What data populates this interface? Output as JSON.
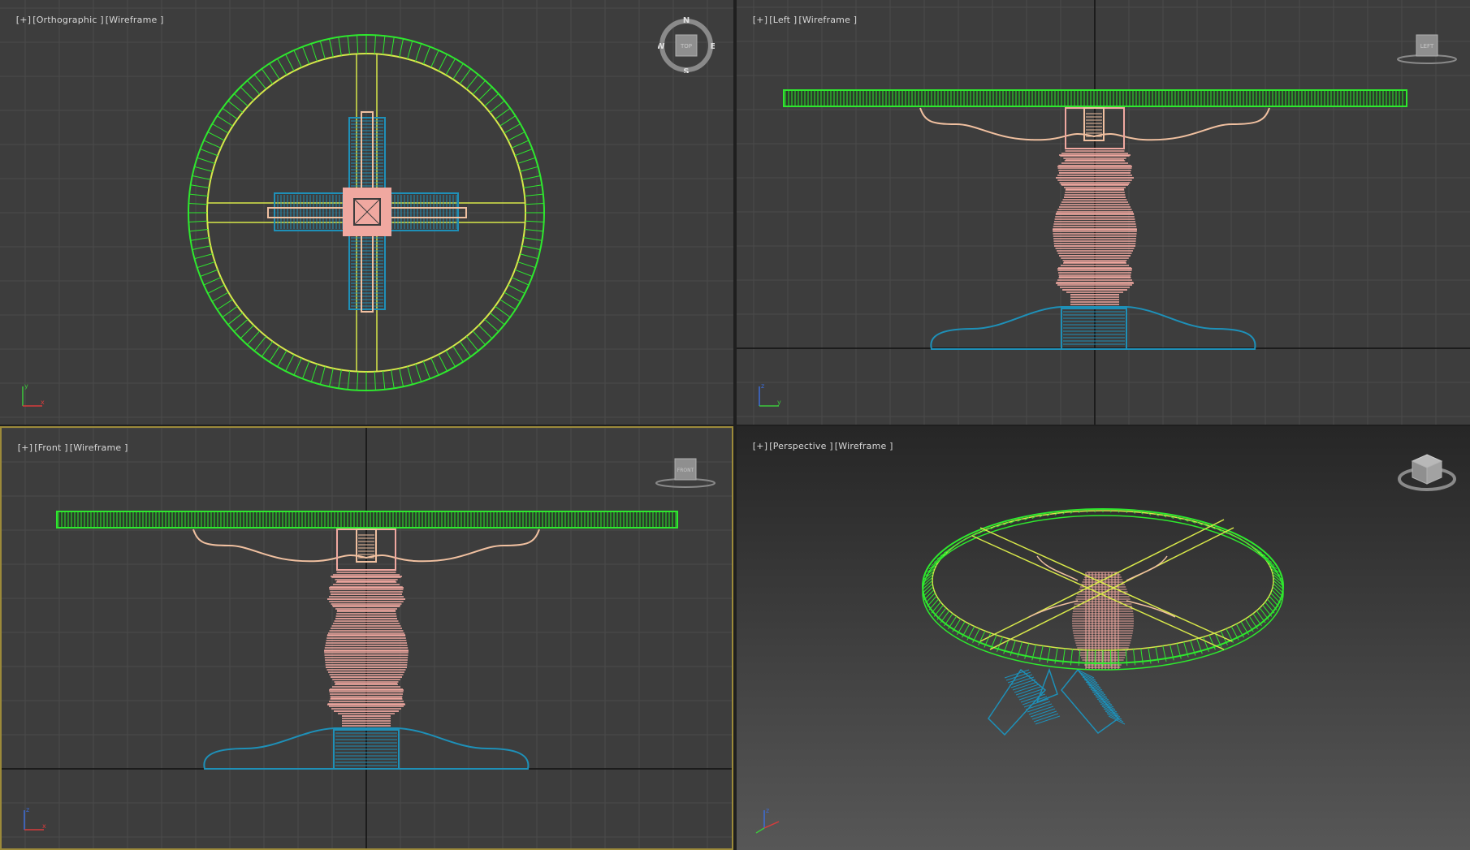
{
  "viewports": {
    "top": {
      "plus": "[+]",
      "view": "[Orthographic ]",
      "shading": "[Wireframe ]"
    },
    "left": {
      "plus": "[+]",
      "view": "[Left ]",
      "shading": "[Wireframe ]"
    },
    "front": {
      "plus": "[+]",
      "view": "[Front ]",
      "shading": "[Wireframe ]"
    },
    "persp": {
      "plus": "[+]",
      "view": "[Perspective ]",
      "shading": "[Wireframe ]"
    }
  },
  "viewcube": {
    "top_face": "TOP",
    "left_face": "LEFT",
    "front_face": "FRONT",
    "compass": {
      "n": "N",
      "s": "S",
      "e": "E",
      "w": "W"
    }
  },
  "axis_labels": {
    "x": "x",
    "y": "y",
    "z": "z"
  },
  "colors": {
    "viewport_bg": "#3d3d3d",
    "grid": "#4a4a4a",
    "axis_line": "#111111",
    "tabletop": "#2ee82e",
    "tabletop_highlight": "#d8e84a",
    "pedestal": "#f0a8a0",
    "apron": "#f0c0a0",
    "base": "#1e90b8",
    "active_border": "#9c8a3a"
  }
}
